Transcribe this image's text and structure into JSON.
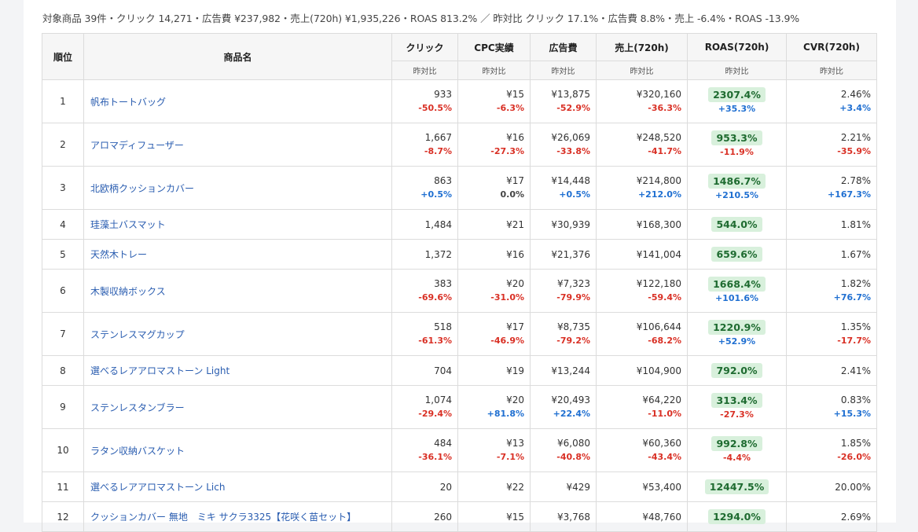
{
  "summary": "対象商品 39件・クリック 14,271・広告費 ¥237,982・売上(720h) ¥1,935,226・ROAS 813.2% ／ 昨対比 クリック 17.1%・広告費 8.8%・売上 -6.4%・ROAS -13.9%",
  "headers": {
    "rank": "順位",
    "name": "商品名",
    "click": "クリック",
    "cpc": "CPC実績",
    "cost": "広告費",
    "sales": "売上(720h)",
    "roas": "ROAS(720h)",
    "cvr": "CVR(720h)",
    "yoy": "昨対比"
  },
  "rows": [
    {
      "rank": "1",
      "name": "帆布トートバッグ",
      "click": "933",
      "click_yoy": "-50.5%",
      "cpc": "¥15",
      "cpc_yoy": "-6.3%",
      "cost": "¥13,875",
      "cost_yoy": "-52.9%",
      "sales": "¥320,160",
      "sales_yoy": "-36.3%",
      "roas": "2307.4%",
      "roas_yoy": "+35.3%",
      "cvr": "2.46%",
      "cvr_yoy": "+3.4%"
    },
    {
      "rank": "2",
      "name": "アロマディフューザー",
      "click": "1,667",
      "click_yoy": "-8.7%",
      "cpc": "¥16",
      "cpc_yoy": "-27.3%",
      "cost": "¥26,069",
      "cost_yoy": "-33.8%",
      "sales": "¥248,520",
      "sales_yoy": "-41.7%",
      "roas": "953.3%",
      "roas_yoy": "-11.9%",
      "cvr": "2.21%",
      "cvr_yoy": "-35.9%"
    },
    {
      "rank": "3",
      "name": "北欧柄クッションカバー",
      "click": "863",
      "click_yoy": "+0.5%",
      "cpc": "¥17",
      "cpc_yoy": "0.0%",
      "cost": "¥14,448",
      "cost_yoy": "+0.5%",
      "sales": "¥214,800",
      "sales_yoy": "+212.0%",
      "roas": "1486.7%",
      "roas_yoy": "+210.5%",
      "cvr": "2.78%",
      "cvr_yoy": "+167.3%"
    },
    {
      "rank": "4",
      "name": "珪藻土バスマット",
      "click": "1,484",
      "click_yoy": "",
      "cpc": "¥21",
      "cpc_yoy": "",
      "cost": "¥30,939",
      "cost_yoy": "",
      "sales": "¥168,300",
      "sales_yoy": "",
      "roas": "544.0%",
      "roas_yoy": "",
      "cvr": "1.81%",
      "cvr_yoy": ""
    },
    {
      "rank": "5",
      "name": "天然木トレー",
      "click": "1,372",
      "click_yoy": "",
      "cpc": "¥16",
      "cpc_yoy": "",
      "cost": "¥21,376",
      "cost_yoy": "",
      "sales": "¥141,004",
      "sales_yoy": "",
      "roas": "659.6%",
      "roas_yoy": "",
      "cvr": "1.67%",
      "cvr_yoy": ""
    },
    {
      "rank": "6",
      "name": "木製収納ボックス",
      "click": "383",
      "click_yoy": "-69.6%",
      "cpc": "¥20",
      "cpc_yoy": "-31.0%",
      "cost": "¥7,323",
      "cost_yoy": "-79.9%",
      "sales": "¥122,180",
      "sales_yoy": "-59.4%",
      "roas": "1668.4%",
      "roas_yoy": "+101.6%",
      "cvr": "1.82%",
      "cvr_yoy": "+76.7%"
    },
    {
      "rank": "7",
      "name": "ステンレスマグカップ",
      "click": "518",
      "click_yoy": "-61.3%",
      "cpc": "¥17",
      "cpc_yoy": "-46.9%",
      "cost": "¥8,735",
      "cost_yoy": "-79.2%",
      "sales": "¥106,644",
      "sales_yoy": "-68.2%",
      "roas": "1220.9%",
      "roas_yoy": "+52.9%",
      "cvr": "1.35%",
      "cvr_yoy": "-17.7%"
    },
    {
      "rank": "8",
      "name": "選べるレアアロマストーン Light",
      "click": "704",
      "click_yoy": "",
      "cpc": "¥19",
      "cpc_yoy": "",
      "cost": "¥13,244",
      "cost_yoy": "",
      "sales": "¥104,900",
      "sales_yoy": "",
      "roas": "792.0%",
      "roas_yoy": "",
      "cvr": "2.41%",
      "cvr_yoy": ""
    },
    {
      "rank": "9",
      "name": "ステンレスタンブラー",
      "click": "1,074",
      "click_yoy": "-29.4%",
      "cpc": "¥20",
      "cpc_yoy": "+81.8%",
      "cost": "¥20,493",
      "cost_yoy": "+22.4%",
      "sales": "¥64,220",
      "sales_yoy": "-11.0%",
      "roas": "313.4%",
      "roas_yoy": "-27.3%",
      "cvr": "0.83%",
      "cvr_yoy": "+15.3%"
    },
    {
      "rank": "10",
      "name": "ラタン収納バスケット",
      "click": "484",
      "click_yoy": "-36.1%",
      "cpc": "¥13",
      "cpc_yoy": "-7.1%",
      "cost": "¥6,080",
      "cost_yoy": "-40.8%",
      "sales": "¥60,360",
      "sales_yoy": "-43.4%",
      "roas": "992.8%",
      "roas_yoy": "-4.4%",
      "cvr": "1.85%",
      "cvr_yoy": "-26.0%"
    },
    {
      "rank": "11",
      "name": "選べるレアアロマストーン Lich",
      "click": "20",
      "click_yoy": "",
      "cpc": "¥22",
      "cpc_yoy": "",
      "cost": "¥429",
      "cost_yoy": "",
      "sales": "¥53,400",
      "sales_yoy": "",
      "roas": "12447.5%",
      "roas_yoy": "",
      "cvr": "20.00%",
      "cvr_yoy": ""
    },
    {
      "rank": "12",
      "name": "クッションカバー 無地　ミキ サクラ3325【花咲く苗セット】",
      "click": "260",
      "click_yoy": "",
      "cpc": "¥15",
      "cpc_yoy": "",
      "cost": "¥3,768",
      "cost_yoy": "",
      "sales": "¥48,760",
      "sales_yoy": "",
      "roas": "1294.0%",
      "roas_yoy": "",
      "cvr": "2.69%",
      "cvr_yoy": ""
    }
  ],
  "colors": {
    "negative": "#d93025",
    "positive": "#1f6fd1",
    "badge_bg": "#d8f0dc",
    "badge_text": "#1e6b30",
    "link": "#2a5db0"
  }
}
